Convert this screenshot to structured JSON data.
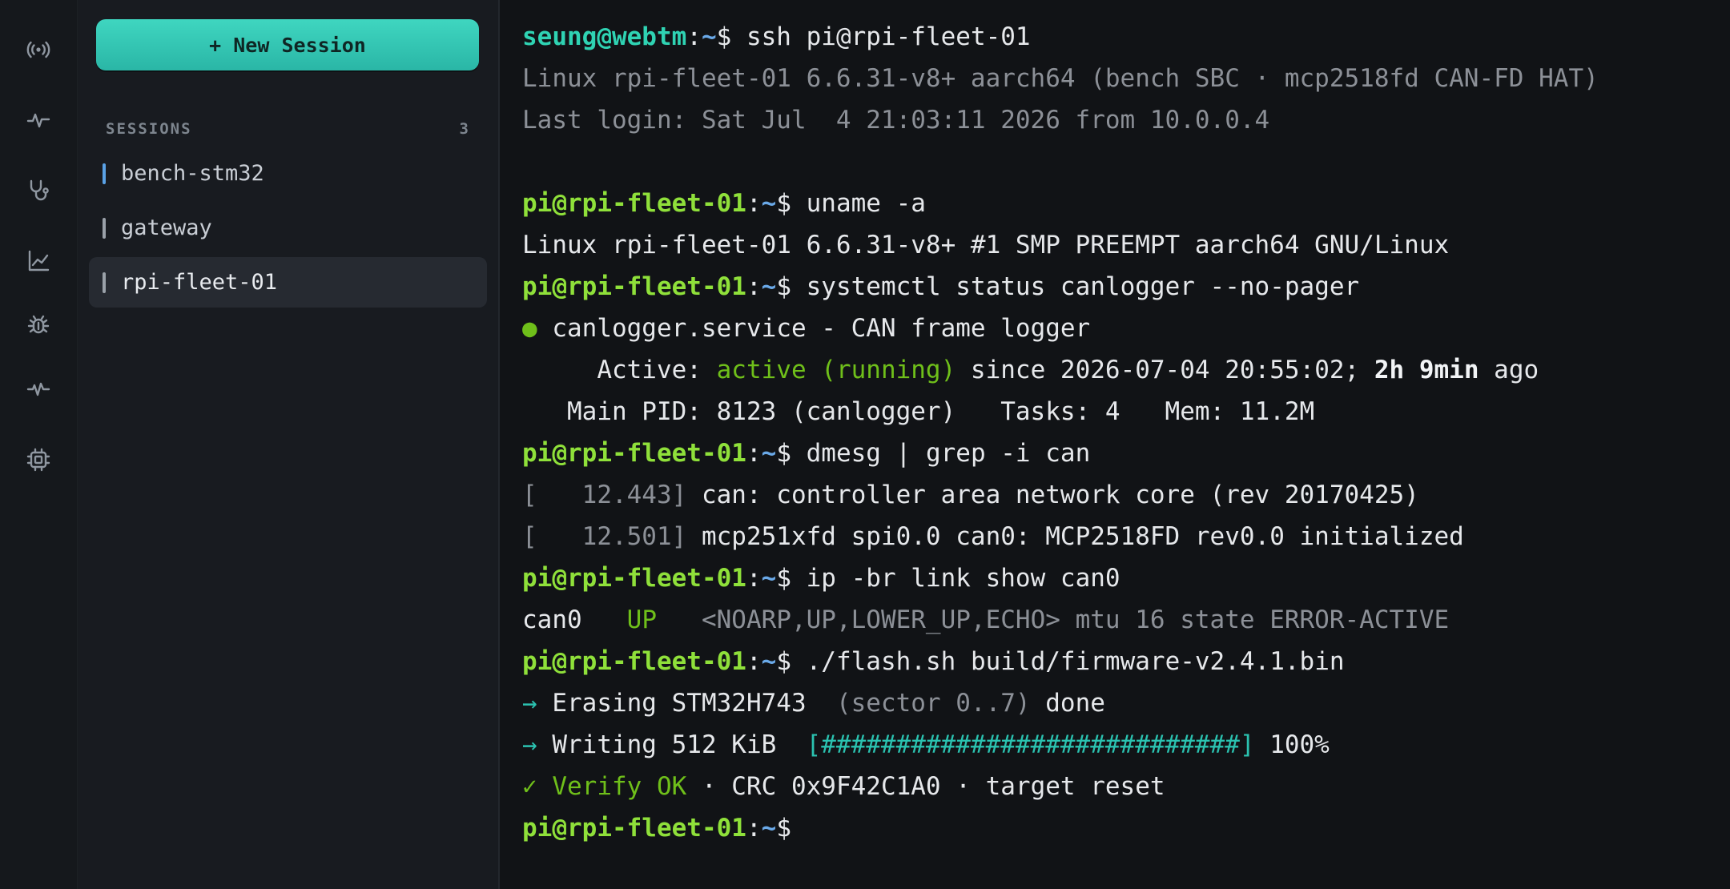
{
  "rail": {
    "icons": [
      "broadcast-icon",
      "pulse-icon",
      "stethoscope-icon",
      "chart-line-icon",
      "bug-icon",
      "heartbeat-icon",
      "chip-icon"
    ]
  },
  "sidebar": {
    "new_session_label": "+ New Session",
    "sessions_heading": "SESSIONS",
    "sessions_count": "3",
    "sessions": [
      {
        "name": "bench-stm32",
        "accent": "#5aa2e6"
      },
      {
        "name": "gateway",
        "accent": "#9aa1a9"
      },
      {
        "name": "rpi-fleet-01",
        "accent": "#9aa1a9",
        "active": true
      }
    ]
  },
  "colors": {
    "accent_teal": "#2fd3b3",
    "host_green": "#8fe03a",
    "path_blue": "#6aa9e8",
    "ok_green": "#6fbf1a"
  },
  "terminal": {
    "l1": {
      "user": "seung@webtm",
      "sep": ":",
      "path": "~",
      "dollar": "$ ",
      "cmd": "ssh pi@rpi-fleet-01"
    },
    "l2": "Linux rpi-fleet-01 6.6.31-v8+ aarch64 (bench SBC · mcp2518fd CAN-FD HAT)",
    "l3": "Last login: Sat Jul  4 21:03:11 2026 from 10.0.0.4",
    "prompt_host": "pi@rpi-fleet-01",
    "prompt_sep": ":",
    "prompt_path": "~",
    "prompt_dollar": "$ ",
    "cmd_uname": "uname -a",
    "out_uname": "Linux rpi-fleet-01 6.6.31-v8+ #1 SMP PREEMPT aarch64 GNU/Linux",
    "cmd_systemctl": "systemctl status canlogger --no-pager",
    "svc_bullet": "● ",
    "svc_line": "canlogger.service - CAN frame logger",
    "active_label": "     Active: ",
    "active_state": "active (running)",
    "active_since": " since 2026-07-04 20:55:02; ",
    "active_dur": "2h 9min",
    "active_ago": " ago",
    "pid_line": "   Main PID: 8123 (canlogger)   Tasks: 4   Mem: 11.2M",
    "cmd_dmesg": "dmesg | grep -i can",
    "dmesg1_ts": "[   12.443]",
    "dmesg1_msg": " can: controller area network core (rev 20170425)",
    "dmesg2_ts": "[   12.501]",
    "dmesg2_msg": " mcp251xfd spi0.0 can0: MCP2518FD rev0.0 initialized",
    "cmd_ip": "ip -br link show can0",
    "ip_iface": "can0   ",
    "ip_state": "UP",
    "ip_rest": "   <NOARP,UP,LOWER_UP,ECHO> mtu 16 state ERROR-ACTIVE",
    "cmd_flash": "./flash.sh build/firmware-v2.4.1.bin",
    "arrow": "→ ",
    "erase_a": "Erasing STM32H743  ",
    "erase_b": "(sector 0..7)",
    "erase_c": " done",
    "write_a": "Writing 512 KiB  ",
    "write_bar": "[############################]",
    "write_pct": " 100%",
    "verify_a": "✓ Verify OK",
    "verify_b": " · CRC 0x9F42C1A0 · target reset"
  }
}
